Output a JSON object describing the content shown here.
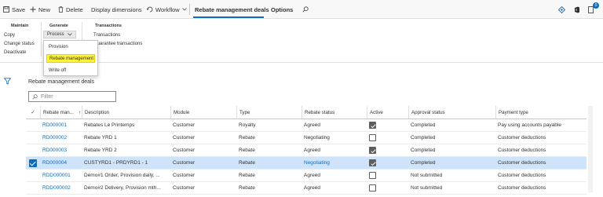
{
  "toolbar": {
    "save": "Save",
    "new": "New",
    "delete": "Delete",
    "display_dimensions": "Display dimensions",
    "workflow": "Workflow",
    "rebate_management_deals": "Rebate management deals",
    "options": "Options",
    "notification_count": "0"
  },
  "ribbon": {
    "maintain": {
      "title": "Maintain",
      "items": [
        "Copy",
        "Change status",
        "Deactivate"
      ]
    },
    "generate": {
      "title": "Generate",
      "process_label": "Process"
    },
    "transactions": {
      "title": "Transactions",
      "items": [
        "Transactions",
        "Guarantee transactions"
      ]
    }
  },
  "process_menu": {
    "items": [
      "Provision",
      "Rebate management",
      "Write off"
    ],
    "highlighted": "Rebate management",
    "highlight_color": "#fff43a"
  },
  "list": {
    "title": "Rebate management deals",
    "filter_placeholder": "Filter"
  },
  "grid": {
    "columns": [
      "Rebate man...",
      "Description",
      "Module",
      "Type",
      "Rebate status",
      "Active",
      "Approval status",
      "Payment type"
    ],
    "sort_indicator": "↑",
    "rows": [
      {
        "id": "RD000001",
        "description": "Rebates Le Printemps",
        "module": "Customer",
        "type": "Royalty",
        "status": "Agreed",
        "active": true,
        "approval": "Completed",
        "payment": "Pay using accounts payable",
        "selected": false
      },
      {
        "id": "RD000002",
        "description": "Rebate YRD 1",
        "module": "Customer",
        "type": "Rebate",
        "status": "Negotiating",
        "active": false,
        "approval": "Completed",
        "payment": "Customer deductions",
        "selected": false
      },
      {
        "id": "RD000003",
        "description": "Rebate YRD 2",
        "module": "Customer",
        "type": "Rebate",
        "status": "Agreed",
        "active": true,
        "approval": "Completed",
        "payment": "Customer deductions",
        "selected": false
      },
      {
        "id": "RD000004",
        "description": "CUSTYRD1 - PRDYRD1 - 1",
        "module": "Customer",
        "type": "Rebate",
        "status": "Negotiating",
        "active": true,
        "approval": "Completed",
        "payment": "Customer deductions",
        "selected": true
      },
      {
        "id": "RDD000001",
        "description": "Demo#1 Order, Provision daily, ...",
        "module": "Customer",
        "type": "Rebate",
        "status": "Agreed",
        "active": false,
        "approval": "Not submitted",
        "payment": "Customer deductions",
        "selected": false
      },
      {
        "id": "RDD000002",
        "description": "Demo#2 Delivery, Provision mth...",
        "module": "Customer",
        "type": "Rebate",
        "status": "Agreed",
        "active": false,
        "approval": "Not submitted",
        "payment": "Customer deductions",
        "selected": false
      }
    ]
  },
  "colors": {
    "accent": "#0f6cbd",
    "selected_row": "#cfe4fa"
  }
}
